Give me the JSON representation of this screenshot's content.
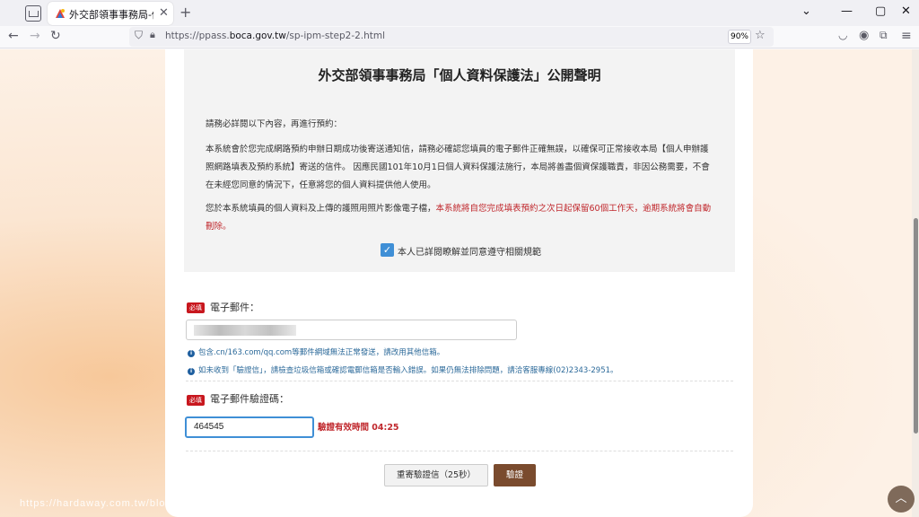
{
  "browser": {
    "tab_title": "外交部領事事務局-個人申辦護照",
    "url_prefix": "https://ppass.",
    "url_domain": "boca.gov.tw",
    "url_path": "/sp-ipm-step2-2.html",
    "zoom": "90%"
  },
  "notice": {
    "title": "外交部領事事務局「個人資料保護法」公開聲明",
    "intro": "請務必詳閱以下內容，再進行預約：",
    "para1": "本系統會於您完成網路預約申辦日期成功後寄送通知信，請務必確認您填員的電子郵件正確無誤，以確保可正常接收本局【個人申辦護照網路填表及預約系統】寄送的信件。 因應民國101年10月1日個人資料保護法施行，本局將善盡個資保護職責，非因公務需要，不會在未經您同意的情況下，任意將您的個人資料提供他人使用。",
    "para2_normal": "您於本系統填員的個人資料及上傳的護照用照片影像電子檔，",
    "para2_red": "本系統將自您完成填表預約之次日起保留60個工作天，逾期系統將會自動刪除。",
    "agree_label": "本人已詳閱瞭解並同意遵守相關規範"
  },
  "form": {
    "required_badge": "必填",
    "email_label": "電子郵件：",
    "info1": "包含.cn/163.com/qq.com等郵件網域無法正常發送，請改用其他信箱。",
    "info2": "如未收到「驗證信」，請檢查垃圾信箱或確認電郵信箱是否輸入錯誤。如果仍無法排除問題，請洽客服專線(02)2343-2951。",
    "code_label": "電子郵件驗證碼：",
    "code_value": "464545",
    "timer_text": "驗證有效時間 04:25",
    "resend_label": "重寄驗證信（25秒）",
    "verify_label": "驗證"
  },
  "watermark": "https://hardaway.com.tw/blo"
}
